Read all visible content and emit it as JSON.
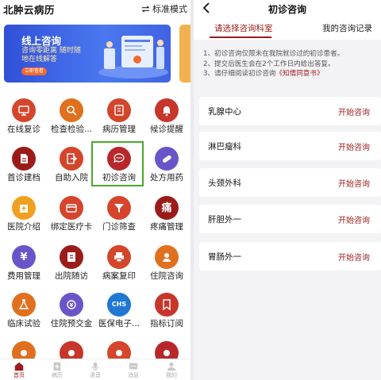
{
  "left": {
    "app_title": "北肿云病历",
    "mode_label": "标准模式",
    "banner": {
      "title": "线上咨询",
      "subtitle": "咨询零距离 随时随地在线解答",
      "button": "立即查看"
    },
    "grid": [
      {
        "label": "在线复诊",
        "icon": "monitor-icon",
        "color": "#d4452c"
      },
      {
        "label": "检查检验...",
        "icon": "magnifier-icon",
        "color": "#e0701e"
      },
      {
        "label": "病历管理",
        "icon": "clipboard-icon",
        "color": "#d4452c"
      },
      {
        "label": "候诊提醒",
        "icon": "bell-icon",
        "color": "#c8362b"
      },
      {
        "label": "首诊建档",
        "icon": "document-icon",
        "color": "#9b1b1b"
      },
      {
        "label": "自助入院",
        "icon": "entry-icon",
        "color": "#d4452c"
      },
      {
        "label": "初诊咨询",
        "icon": "chat-icon",
        "color": "#b8282b"
      },
      {
        "label": "处方用药",
        "icon": "pill-icon",
        "color": "#6a55c8"
      },
      {
        "label": "医院介绍",
        "icon": "hospital-icon",
        "color": "#f0a01e"
      },
      {
        "label": "绑定医疗卡",
        "icon": "card-icon",
        "color": "#d4452c"
      },
      {
        "label": "门诊筛查",
        "icon": "funnel-icon",
        "color": "#d4452c"
      },
      {
        "label": "疼痛管理",
        "icon": "pain-icon",
        "color": "#9b1b1b",
        "glyph": "痛"
      },
      {
        "label": "费用管理",
        "icon": "yuan-icon",
        "color": "#6a55c8",
        "glyph": "¥"
      },
      {
        "label": "出院随访",
        "icon": "followup-icon",
        "color": "#9b1b1b"
      },
      {
        "label": "病案复印",
        "icon": "printer-icon",
        "color": "#d4452c"
      },
      {
        "label": "住院咨询",
        "icon": "nurse-icon",
        "color": "#e0701e"
      },
      {
        "label": "临床试验",
        "icon": "flask-icon",
        "color": "#e0701e"
      },
      {
        "label": "住院预交金",
        "icon": "deposit-icon",
        "color": "#6a55c8"
      },
      {
        "label": "医保电子...",
        "icon": "chs-icon",
        "color": "#1e78d4",
        "glyph": "CHS"
      },
      {
        "label": "指标订阅",
        "icon": "bookmark-icon",
        "color": "#c8362b"
      },
      {
        "label": "",
        "icon": "partial-icon",
        "color": "#e0701e"
      },
      {
        "label": "",
        "icon": "partial-icon",
        "color": "#c8362b"
      },
      {
        "label": "",
        "icon": "partial-icon",
        "color": "#d4452c"
      },
      {
        "label": "",
        "icon": "partial-icon",
        "color": "#b8282b"
      }
    ],
    "nav": [
      {
        "label": "首页",
        "icon": "home-icon"
      },
      {
        "label": "病历",
        "icon": "record-icon"
      },
      {
        "label": "语音",
        "icon": "mic-icon"
      },
      {
        "label": "消息",
        "icon": "message-icon"
      },
      {
        "label": "我的",
        "icon": "user-icon"
      }
    ]
  },
  "right": {
    "title": "初诊咨询",
    "tabs": [
      "请选择咨询科室",
      "我的咨询记录"
    ],
    "notice": {
      "line1": "1、初诊咨询仅限未在我院就诊过的初诊患者。",
      "line2": "2、提交后医生会在2个工作日内给出答复。",
      "line3_prefix": "3、请仔细阅读初诊咨询",
      "line3_link": "《知情同意书》"
    },
    "departments": [
      {
        "name": "乳腺中心",
        "action": "开始咨询"
      },
      {
        "name": "淋巴瘤科",
        "action": "开始咨询"
      },
      {
        "name": "头颈外科",
        "action": "开始咨询"
      },
      {
        "name": "肝胆外一",
        "action": "开始咨询"
      },
      {
        "name": "胃肠外一",
        "action": "开始咨询"
      }
    ]
  }
}
